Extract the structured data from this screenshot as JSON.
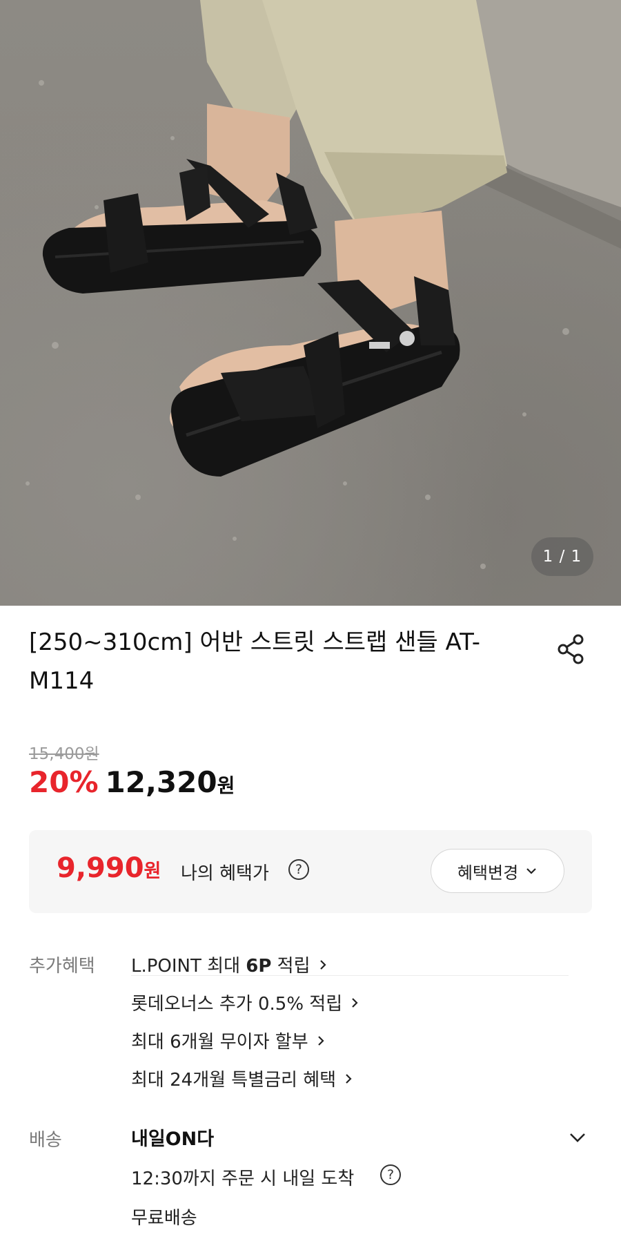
{
  "gallery": {
    "counter": "1 / 1"
  },
  "product": {
    "title": "[250~310cm] 어반 스트릿 스트랩 샌들 AT-M114",
    "original_price": "15,400원",
    "discount": "20%",
    "price": "12,320",
    "price_unit": "원"
  },
  "benefit": {
    "price": "9,990",
    "price_unit": "원",
    "label": "나의 혜택가",
    "help": "?",
    "change_button": "혜택변경"
  },
  "extra_benefits": {
    "label": "추가혜택",
    "items": [
      {
        "prefix": "L.POINT 최대 ",
        "strong": "6P",
        "suffix": " 적립"
      },
      {
        "text": "롯데오너스 추가 0.5% 적립"
      },
      {
        "text": "최대 6개월 무이자 할부"
      },
      {
        "text": "최대 24개월 특별금리 혜택"
      }
    ]
  },
  "shipping": {
    "label": "배송",
    "title": "내일ON다",
    "order_info": "12:30까지 주문 시 내일 도착",
    "help": "?",
    "fee": "무료배송"
  },
  "colors": {
    "accent_red": "#e8252c",
    "benefit_bg": "#f6f6f6"
  },
  "icons": [
    "share-icon",
    "help-circle-icon",
    "chevron-down-icon",
    "chevron-right-icon"
  ]
}
